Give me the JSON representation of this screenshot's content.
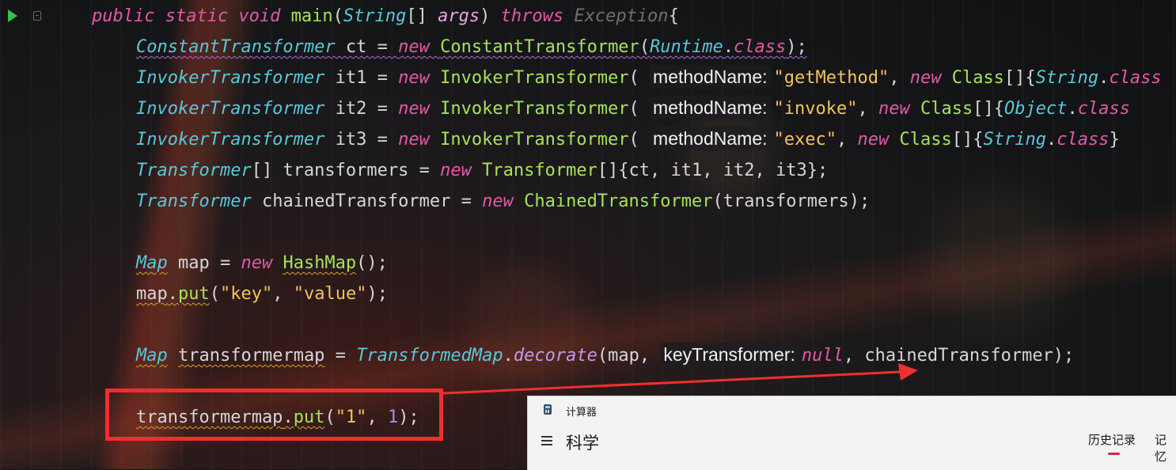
{
  "editor": {
    "lines": [
      [
        {
          "t": "public static void ",
          "c": "kw"
        },
        {
          "t": "main",
          "c": "fn"
        },
        {
          "t": "(",
          "c": "pl"
        },
        {
          "t": "String",
          "c": "ty"
        },
        {
          "t": "[] ",
          "c": "pl"
        },
        {
          "t": "args",
          "c": "pa"
        },
        {
          "t": ") ",
          "c": "pl"
        },
        {
          "t": "throws ",
          "c": "kw"
        },
        {
          "t": "Exception",
          "c": "dim"
        },
        {
          "t": "{",
          "c": "pl"
        }
      ],
      [
        {
          "t": "ConstantTransformer",
          "c": "ty sqp"
        },
        {
          "t": " ct = ",
          "c": "pl sqp"
        },
        {
          "t": "new ",
          "c": "kw sqp"
        },
        {
          "t": "ConstantTransformer",
          "c": "fn sqp"
        },
        {
          "t": "(",
          "c": "pl sqp"
        },
        {
          "t": "Runtime",
          "c": "ty sqp"
        },
        {
          "t": ".",
          "c": "pl sqp"
        },
        {
          "t": "class",
          "c": "kw sqp"
        },
        {
          "t": ");",
          "c": "pl sqp"
        }
      ],
      [
        {
          "t": "InvokerTransformer",
          "c": "ty"
        },
        {
          "t": " it1 = ",
          "c": "pl"
        },
        {
          "t": "new ",
          "c": "kw"
        },
        {
          "t": "InvokerTransformer",
          "c": "fn"
        },
        {
          "t": "( ",
          "c": "pl"
        },
        {
          "t": "methodName:",
          "c": "hint"
        },
        {
          "t": "\"getMethod\"",
          "c": "st"
        },
        {
          "t": ", ",
          "c": "pl"
        },
        {
          "t": "new ",
          "c": "kw"
        },
        {
          "t": "Class",
          "c": "fn"
        },
        {
          "t": "[]{",
          "c": "pl"
        },
        {
          "t": "String",
          "c": "ty"
        },
        {
          "t": ".",
          "c": "pl"
        },
        {
          "t": "class",
          "c": "kw"
        }
      ],
      [
        {
          "t": "InvokerTransformer",
          "c": "ty"
        },
        {
          "t": " it2 = ",
          "c": "pl"
        },
        {
          "t": "new ",
          "c": "kw"
        },
        {
          "t": "InvokerTransformer",
          "c": "fn"
        },
        {
          "t": "( ",
          "c": "pl"
        },
        {
          "t": "methodName:",
          "c": "hint"
        },
        {
          "t": "\"invoke\"",
          "c": "st"
        },
        {
          "t": ", ",
          "c": "pl"
        },
        {
          "t": "new ",
          "c": "kw"
        },
        {
          "t": "Class",
          "c": "fn"
        },
        {
          "t": "[]{",
          "c": "pl"
        },
        {
          "t": "Object",
          "c": "ty"
        },
        {
          "t": ".",
          "c": "pl"
        },
        {
          "t": "class",
          "c": "kw"
        }
      ],
      [
        {
          "t": "InvokerTransformer",
          "c": "ty"
        },
        {
          "t": " it3 = ",
          "c": "pl"
        },
        {
          "t": "new ",
          "c": "kw"
        },
        {
          "t": "InvokerTransformer",
          "c": "fn"
        },
        {
          "t": "( ",
          "c": "pl"
        },
        {
          "t": "methodName:",
          "c": "hint"
        },
        {
          "t": "\"exec\"",
          "c": "st"
        },
        {
          "t": ", ",
          "c": "pl"
        },
        {
          "t": "new ",
          "c": "kw"
        },
        {
          "t": "Class",
          "c": "fn"
        },
        {
          "t": "[]{",
          "c": "pl"
        },
        {
          "t": "String",
          "c": "ty"
        },
        {
          "t": ".",
          "c": "pl"
        },
        {
          "t": "class",
          "c": "kw"
        },
        {
          "t": "}",
          "c": "pl"
        }
      ],
      [
        {
          "t": "Transformer",
          "c": "ty"
        },
        {
          "t": "[] transformers = ",
          "c": "pl"
        },
        {
          "t": "new ",
          "c": "kw"
        },
        {
          "t": "Transformer",
          "c": "fn"
        },
        {
          "t": "[]{ct, it1, it2, it3};",
          "c": "pl"
        }
      ],
      [
        {
          "t": "Transformer",
          "c": "ty"
        },
        {
          "t": " chainedTransformer = ",
          "c": "pl"
        },
        {
          "t": "new ",
          "c": "kw"
        },
        {
          "t": "ChainedTransformer",
          "c": "fn"
        },
        {
          "t": "(transformers);",
          "c": "pl"
        }
      ],
      [],
      [
        {
          "t": "Map",
          "c": "ty sq"
        },
        {
          "t": " map = ",
          "c": "pl"
        },
        {
          "t": "new ",
          "c": "kw"
        },
        {
          "t": "HashMap",
          "c": "fn sq"
        },
        {
          "t": "();",
          "c": "pl"
        }
      ],
      [
        {
          "t": "map",
          "c": "pl sq"
        },
        {
          "t": ".",
          "c": "pl sq"
        },
        {
          "t": "put",
          "c": "fn sq"
        },
        {
          "t": "(",
          "c": "pl"
        },
        {
          "t": "\"key\"",
          "c": "st"
        },
        {
          "t": ", ",
          "c": "pl"
        },
        {
          "t": "\"value\"",
          "c": "st"
        },
        {
          "t": ");",
          "c": "pl"
        }
      ],
      [],
      [
        {
          "t": "Map",
          "c": "ty sq"
        },
        {
          "t": " ",
          "c": "pl"
        },
        {
          "t": "transformermap",
          "c": "pl sq"
        },
        {
          "t": " = ",
          "c": "pl"
        },
        {
          "t": "TransformedMap",
          "c": "ty"
        },
        {
          "t": ".",
          "c": "pl"
        },
        {
          "t": "decorate",
          "c": "mth"
        },
        {
          "t": "(map, ",
          "c": "pl"
        },
        {
          "t": "keyTransformer:",
          "c": "hint"
        },
        {
          "t": "null",
          "c": "kw"
        },
        {
          "t": ", ",
          "c": "pl"
        },
        {
          "t": "chainedTransformer);",
          "c": "pl"
        }
      ],
      [],
      [
        {
          "t": "transformermap",
          "c": "pl sq"
        },
        {
          "t": ".",
          "c": "pl sq"
        },
        {
          "t": "put",
          "c": "fn sq"
        },
        {
          "t": "(",
          "c": "pl"
        },
        {
          "t": "\"1\"",
          "c": "st"
        },
        {
          "t": ", ",
          "c": "pl"
        },
        {
          "t": "1",
          "c": "nu"
        },
        {
          "t": ");",
          "c": "pl"
        }
      ]
    ]
  },
  "calculator": {
    "title": "计算器",
    "mode": "科学",
    "tab_history": "历史记录",
    "tab_memory": "记忆"
  },
  "colors": {
    "highlight": "#ee2f2f",
    "run_icon": "#37c24a",
    "tab_accent": "#d6254b"
  },
  "icons": [
    "run-icon",
    "fold-icon",
    "calculator-icon",
    "hamburger-menu-icon"
  ]
}
